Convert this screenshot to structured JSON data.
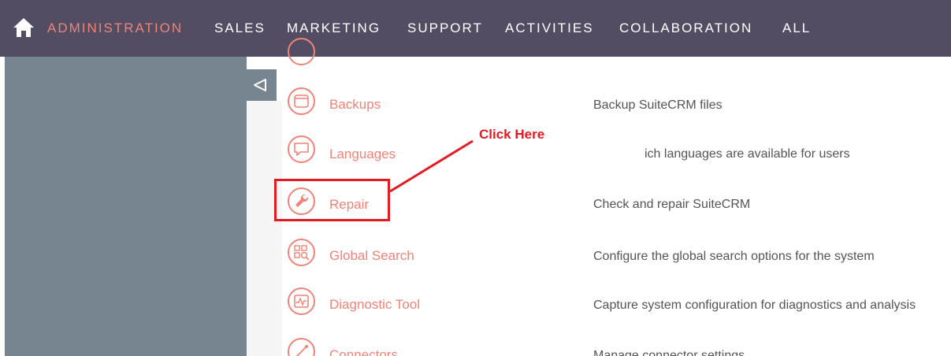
{
  "nav": {
    "home_icon": "home-icon",
    "items": [
      {
        "label": "ADMINISTRATION",
        "active": true
      },
      {
        "label": "SALES"
      },
      {
        "label": "MARKETING"
      },
      {
        "label": "SUPPORT"
      },
      {
        "label": "ACTIVITIES"
      },
      {
        "label": "COLLABORATION"
      },
      {
        "label": "ALL"
      }
    ],
    "background": "#534d64",
    "active_color": "#f08377"
  },
  "sidebar": {
    "toggle_icon": "collapse-triangle-icon",
    "background": "#778591"
  },
  "admin_rows": [
    {
      "label": "Backups",
      "description": "Backup SuiteCRM files",
      "icon": "backup-icon"
    },
    {
      "label": "Languages",
      "description": "ich languages are available for users",
      "icon": "speech-bubble-icon"
    },
    {
      "label": "Repair",
      "description": "Check and repair SuiteCRM",
      "icon": "wrench-icon"
    },
    {
      "label": "Global Search",
      "description": "Configure the global search options for the system",
      "icon": "global-search-icon"
    },
    {
      "label": "Diagnostic Tool",
      "description": "Capture system configuration for diagnostics and analysis",
      "icon": "diagnostic-icon"
    },
    {
      "label": "Connectors",
      "description": "Manage connector settings",
      "icon": "connectors-icon"
    }
  ],
  "annotation": {
    "callout_text": "Click Here",
    "color": "#e11b22",
    "target": "Repair"
  }
}
